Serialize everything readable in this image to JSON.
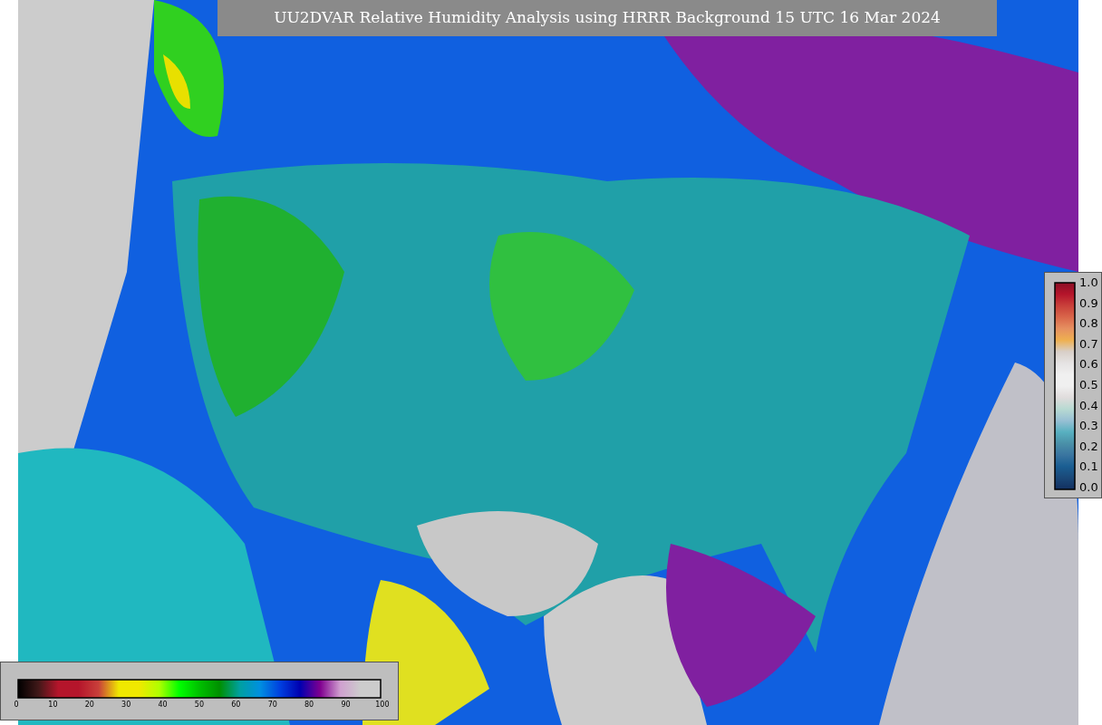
{
  "title": "UU2DVAR Relative Humidity Analysis using HRRR Background 15 UTC 16 Mar 2024",
  "vertical_colorbar": {
    "ticks": [
      "1.0",
      "0.9",
      "0.8",
      "0.7",
      "0.6",
      "0.5",
      "0.4",
      "0.3",
      "0.2",
      "0.1",
      "0.0"
    ]
  },
  "horizontal_colorbar": {
    "ticks": [
      "0",
      "10",
      "20",
      "30",
      "40",
      "50",
      "60",
      "70",
      "80",
      "90",
      "100"
    ]
  }
}
